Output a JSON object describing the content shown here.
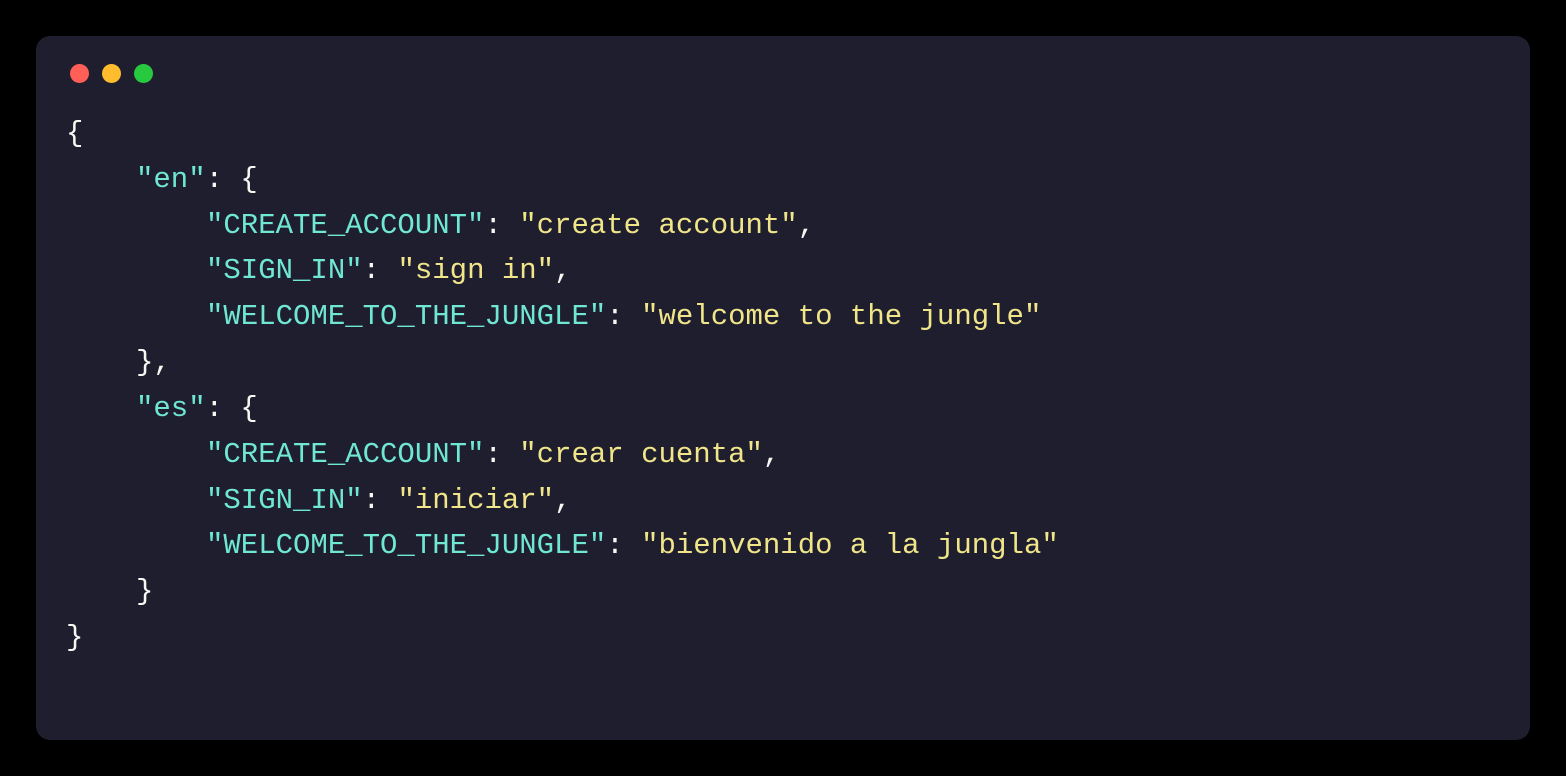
{
  "code": {
    "open_brace": "{",
    "close_brace": "}",
    "close_brace_comma": "},",
    "colon_open": ": {",
    "colon_sep": ": ",
    "comma": ",",
    "langs": {
      "en": {
        "label": "\"en\"",
        "keys": {
          "create_account": "\"CREATE_ACCOUNT\"",
          "sign_in": "\"SIGN_IN\"",
          "welcome": "\"WELCOME_TO_THE_JUNGLE\""
        },
        "values": {
          "create_account": "\"create account\"",
          "sign_in": "\"sign in\"",
          "welcome": "\"welcome to the jungle\""
        }
      },
      "es": {
        "label": "\"es\"",
        "keys": {
          "create_account": "\"CREATE_ACCOUNT\"",
          "sign_in": "\"SIGN_IN\"",
          "welcome": "\"WELCOME_TO_THE_JUNGLE\""
        },
        "values": {
          "create_account": "\"crear cuenta\"",
          "sign_in": "\"iniciar\"",
          "welcome": "\"bienvenido a la jungla\""
        }
      }
    }
  }
}
